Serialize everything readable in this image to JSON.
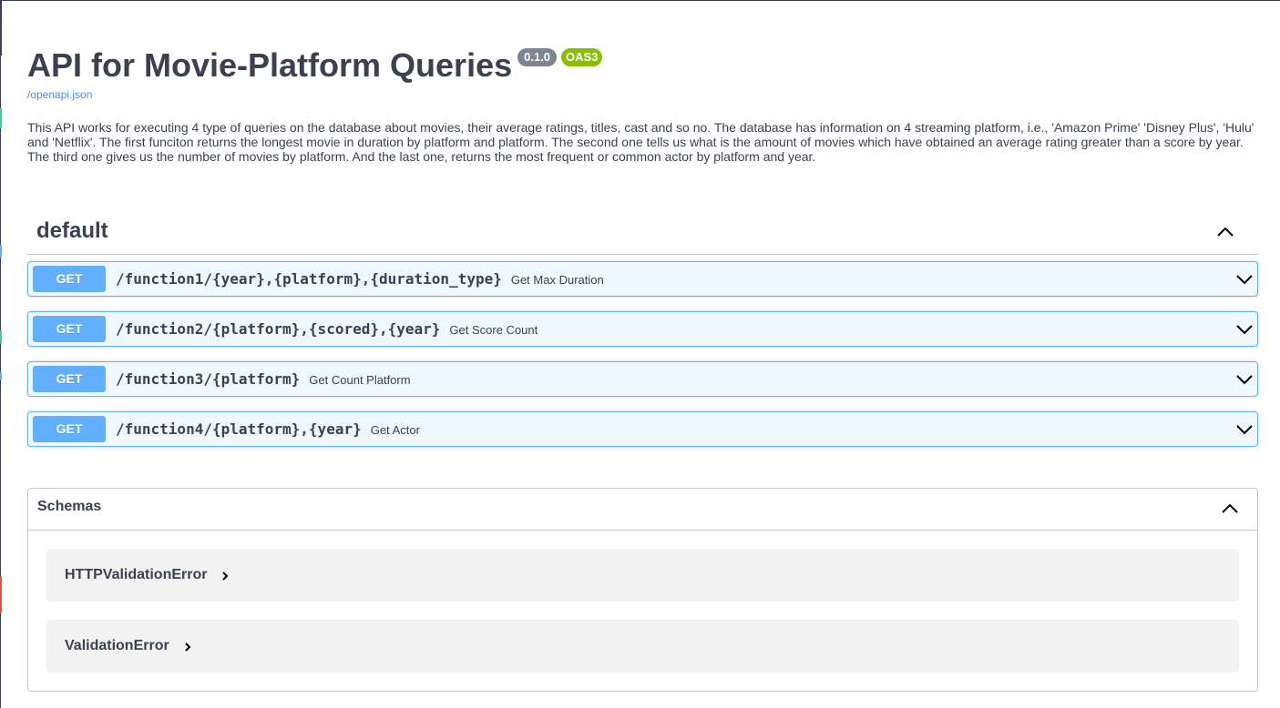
{
  "info": {
    "title": "API for Movie-Platform Queries",
    "version": "0.1.0",
    "oas_badge": "OAS3",
    "spec_link": "/openapi.json",
    "description": "This API works for executing 4 type of queries on the database about movies, their average ratings, titles, cast and so no. The database has information on 4 streaming platform, i.e., 'Amazon Prime' 'Disney Plus', 'Hulu' and 'Netflix'. The first funciton returns the longest movie in duration by platform and platform. The second one tells us what is the amount of movies which have obtained an average rating greater than a score by year. The third one gives us the number of movies by platform. And the last one, returns the most frequent or common actor by platform and year."
  },
  "tag": {
    "name": "default",
    "expanded": true,
    "toggle_icon": "chevron-up-icon"
  },
  "operations": [
    {
      "method": "GET",
      "path": "/function1/{year},{platform},{duration_type}",
      "summary": "Get Max Duration"
    },
    {
      "method": "GET",
      "path": "/function2/{platform},{scored},{year}",
      "summary": "Get Score Count"
    },
    {
      "method": "GET",
      "path": "/function3/{platform}",
      "summary": "Get Count Platform"
    },
    {
      "method": "GET",
      "path": "/function4/{platform},{year}",
      "summary": "Get Actor"
    }
  ],
  "schemas": {
    "title": "Schemas",
    "expanded": true,
    "models": [
      {
        "name": "HTTPValidationError"
      },
      {
        "name": "ValidationError"
      }
    ]
  },
  "colors": {
    "get_method": "#61affe",
    "version_badge": "#7d8492",
    "oas_badge": "#89bf04",
    "link": "#4990e2",
    "text": "#3b4151"
  }
}
